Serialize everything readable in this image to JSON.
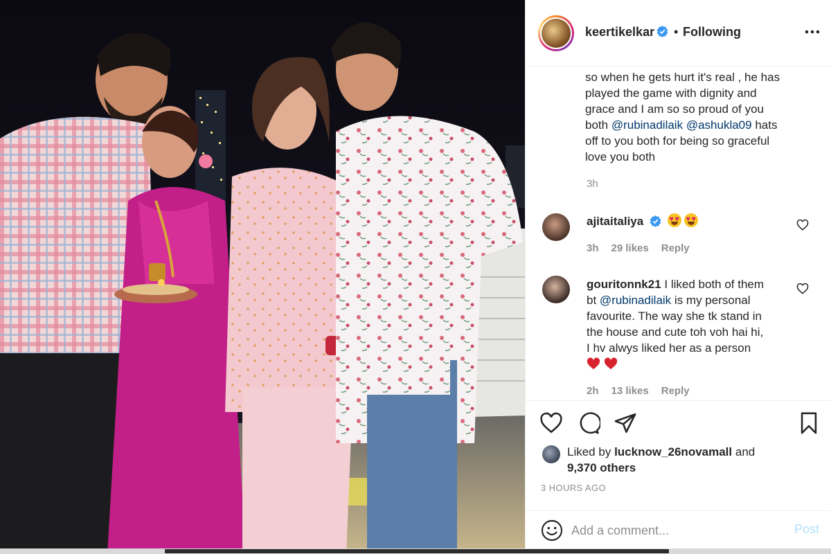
{
  "post": {
    "author": "keertikelkar",
    "follow_separator": "•",
    "follow_status": "Following",
    "caption_lines": [
      "so when he gets hurt it's real , he has",
      "played the game with dignity and",
      "grace and I am so so proud of you",
      "both",
      "@rubinadilaik",
      "@ashukla09",
      "hats",
      "off to you both for being so graceful",
      "love you both"
    ],
    "caption_time": "3h"
  },
  "comments": [
    {
      "username": "ajitaitaliya",
      "verified": true,
      "text": "",
      "emojis": [
        "heart-eyes-emoji",
        "heart-eyes-emoji"
      ],
      "time": "3h",
      "likes": "29 likes",
      "reply": "Reply"
    },
    {
      "username": "gouritonnk21",
      "text_lines": [
        "I liked both of them",
        "bt",
        "@rubinadilaik",
        "is my personal",
        "favourite. The way she tk stand in",
        "the house and cute toh voh hai hi,",
        "I hv alwys liked her as a person"
      ],
      "emojis": [
        "red-heart-emoji",
        "red-heart-emoji"
      ],
      "time": "2h",
      "likes": "13 likes",
      "reply": "Reply"
    }
  ],
  "engagement": {
    "liked_by_prefix": "Liked by",
    "liked_by_user": "lucknow_26novamall",
    "and_text": "and",
    "others": "9,370 others",
    "timestamp": "3 HOURS AGO"
  },
  "composer": {
    "placeholder": "Add a comment...",
    "post_label": "Post"
  },
  "icons": {
    "like": "heart-outline-icon",
    "comment": "comment-bubble-icon",
    "share": "paper-plane-icon",
    "save": "bookmark-icon",
    "emoji": "smiley-icon",
    "more": "more-options-icon",
    "verified": "verified-badge-icon"
  },
  "colors": {
    "mention": "#00376b",
    "verified": "#3897f0",
    "muted": "#8e8e8e",
    "post_disabled": "#b2dffc"
  }
}
